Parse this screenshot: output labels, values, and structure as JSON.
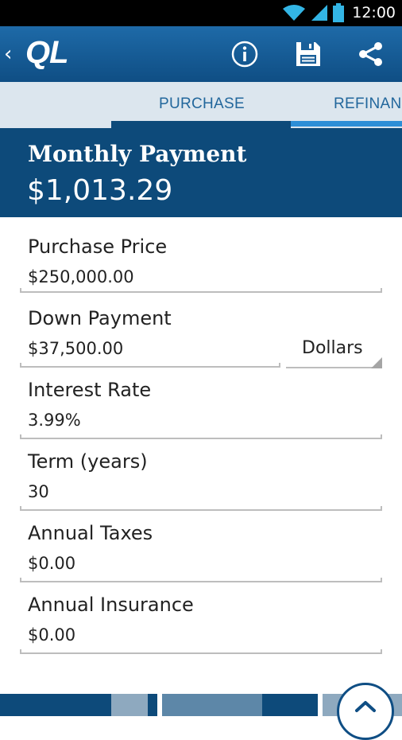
{
  "status_bar": {
    "time": "12:00"
  },
  "app_bar": {
    "back_glyph": "‹",
    "logo": "QL",
    "actions": [
      "info-icon",
      "save-icon",
      "share-icon"
    ]
  },
  "tabs": [
    {
      "label": "PURCHASE"
    },
    {
      "label": "REFINANCE"
    }
  ],
  "summary": {
    "label": "Monthly Payment",
    "value": "$1,013.29"
  },
  "fields": {
    "purchase_price": {
      "label": "Purchase Price",
      "value": "$250,000.00"
    },
    "down_payment": {
      "label": "Down Payment",
      "value": "$37,500.00",
      "unit": "Dollars"
    },
    "interest_rate": {
      "label": "Interest Rate",
      "value": "3.99%"
    },
    "term": {
      "label": "Term (years)",
      "value": "30"
    },
    "annual_taxes": {
      "label": "Annual Taxes",
      "value": "$0.00"
    },
    "annual_insurance": {
      "label": "Annual Insurance",
      "value": "$0.00"
    }
  },
  "colors": {
    "primary": "#0d4a7a",
    "accent": "#1e6aa8",
    "tab_bg": "#dce6ee",
    "tab_text": "#22679c"
  },
  "fab": {
    "icon": "chevron-up-icon"
  }
}
